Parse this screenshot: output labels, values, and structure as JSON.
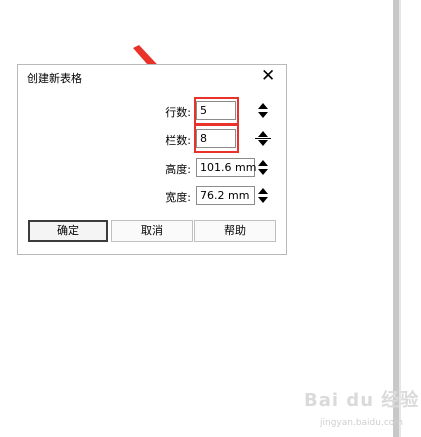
{
  "dialog": {
    "title": "创建新表格",
    "close_glyph": "✕",
    "rows_label": "行数:",
    "rows_value": "5",
    "cols_label": "栏数:",
    "cols_value": "8",
    "height_label": "高度:",
    "height_value": "101.6 mm",
    "width_label": "宽度:",
    "width_value": "76.2 mm",
    "ok_label": "确定",
    "cancel_label": "取消",
    "help_label": "帮助"
  },
  "annotation": {
    "arrow_color": "#e8322a",
    "highlight_color": "#e8322a"
  },
  "watermark": {
    "text": "Bai du 经验",
    "subtext": "jingyan.baidu.com"
  }
}
